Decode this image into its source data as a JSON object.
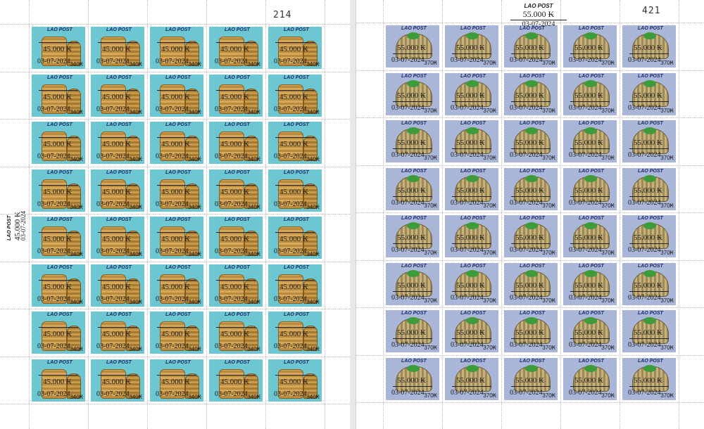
{
  "sheets": [
    {
      "id": "left",
      "sheet_number": "214",
      "stamp_face_value": "340₭",
      "stamp_brand": "LAO POST",
      "overprint": {
        "value": "45.000 ₭",
        "date": "03-07-2024"
      },
      "margin_overprint": {
        "brand": "LAO POST",
        "value": "45.000 ₭",
        "date": "03-07-2024"
      },
      "background": "#6cc7d3"
    },
    {
      "id": "right",
      "sheet_number": "421",
      "stamp_face_value": "370₭",
      "stamp_brand": "LAO POST",
      "overprint": {
        "value": "55.000 ₭",
        "date": "03-07-2024"
      },
      "margin_overprint": {
        "brand": "LAO POST",
        "value": "55.000 ₭",
        "date": "03-07-2024"
      },
      "background": "#a9b6d8"
    }
  ]
}
